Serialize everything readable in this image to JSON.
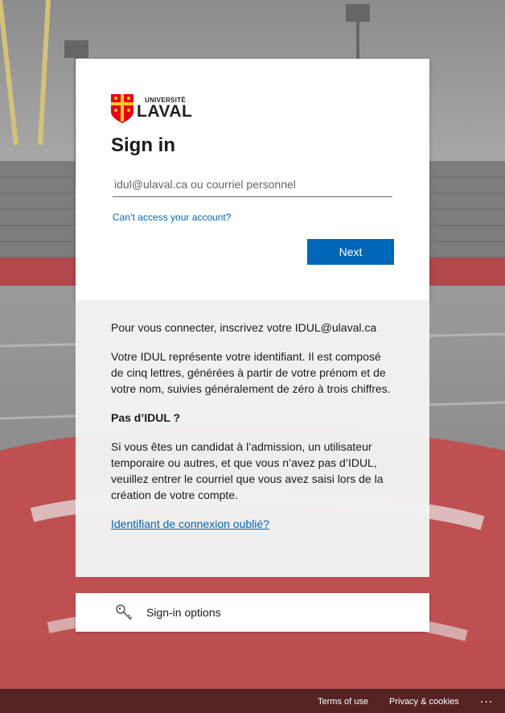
{
  "logo": {
    "line1": "UNIVERSITÉ",
    "line2": "LAVAL"
  },
  "signin": {
    "title": "Sign in",
    "email_placeholder": "idul@ulaval.ca ou courriel personnel",
    "email_value": "",
    "cant_access": "Can’t access your account?",
    "next_label": "Next"
  },
  "info": {
    "p1": "Pour vous connecter, inscrivez votre IDUL@ulaval.ca",
    "p2": "Votre IDUL représente votre identifiant. Il est composé de cinq lettres, générées à partir de votre prénom et de votre nom, suivies généralement de zéro à trois chiffres.",
    "p3": "Pas d’IDUL ?",
    "p4": "Si vous êtes un candidat à l’admission, un utilisateur temporaire ou autres, et que vous n’avez pas d’IDUL, veuillez entrer le courriel que vous avez saisi lors de la création de votre compte.",
    "forgot_link": "Identifiant de connexion oublié?"
  },
  "options": {
    "label": "Sign-in options",
    "icon": "key-icon"
  },
  "footer": {
    "terms": "Terms of use",
    "privacy": "Privacy & cookies",
    "more": "..."
  },
  "colors": {
    "accent": "#0067b8",
    "text": "#1b1b1b",
    "field_red": "#c44a4d",
    "logo_red": "#e30513",
    "logo_gold": "#ffc72c"
  }
}
